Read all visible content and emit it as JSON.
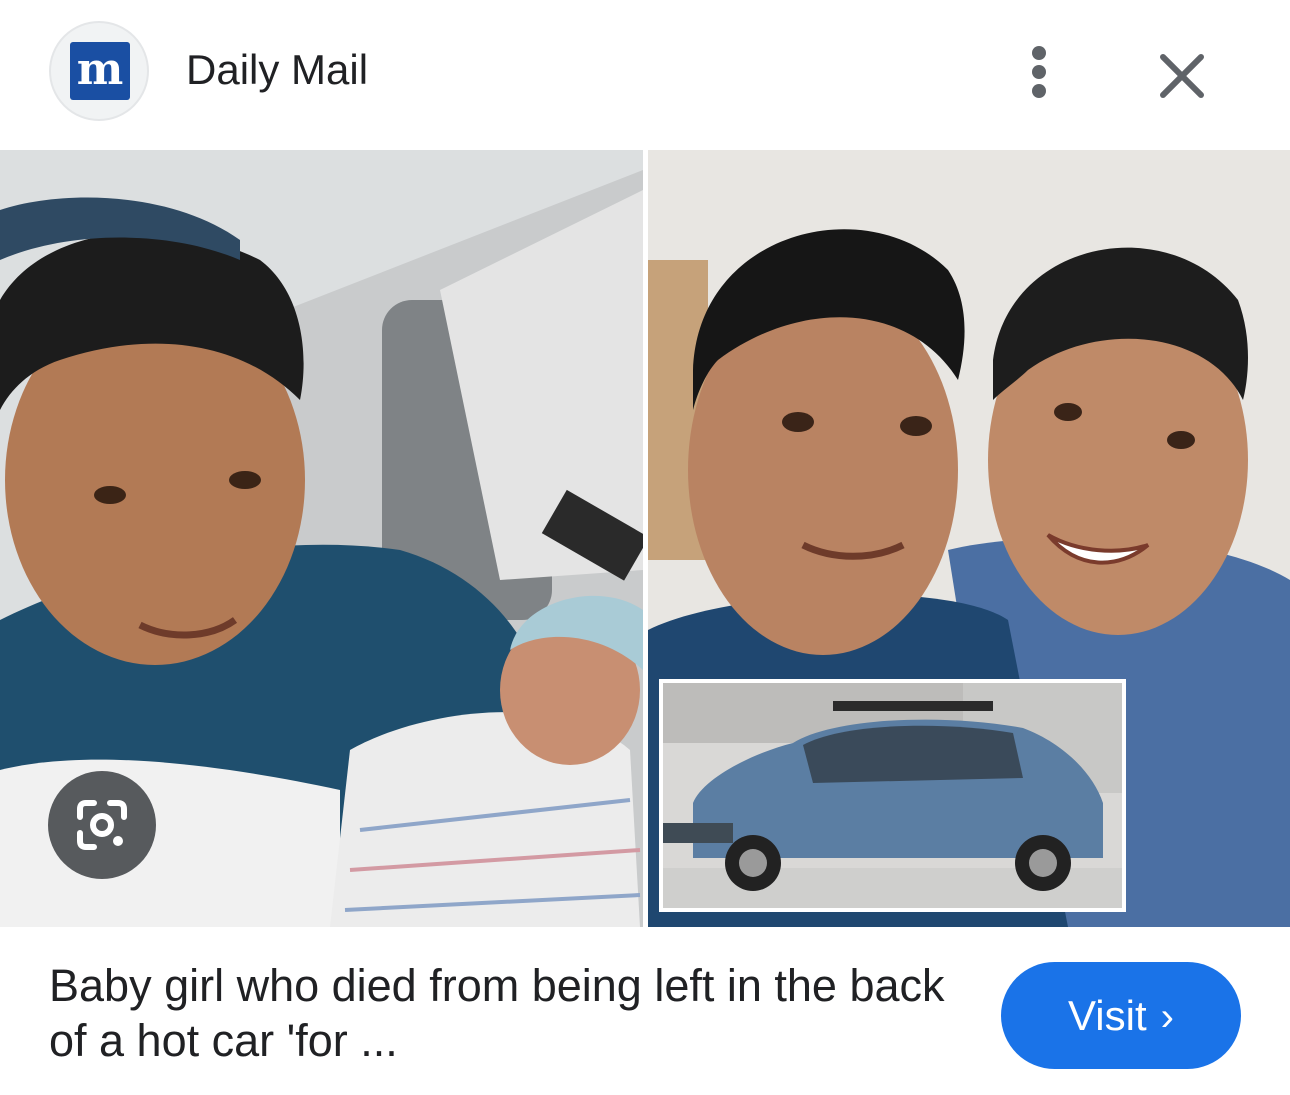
{
  "header": {
    "logo_letter": "m",
    "source_name": "Daily Mail",
    "menu_icon": "more-vert-icon",
    "close_icon": "close-icon"
  },
  "image": {
    "lens_icon": "google-lens-icon"
  },
  "footer": {
    "caption": "Baby girl who died from being left in the back of a hot car 'for ...",
    "visit_label": "Visit",
    "visit_chevron": "›"
  },
  "colors": {
    "accent": "#1a73e8",
    "logo_bg": "#1a4fa3",
    "text": "#202124",
    "icon": "#5f6368"
  }
}
